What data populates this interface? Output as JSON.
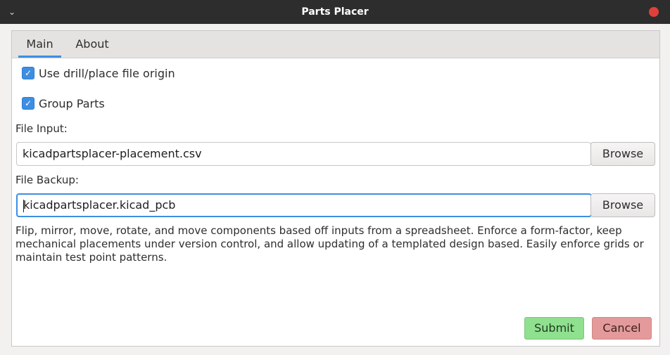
{
  "window": {
    "title": "Parts Placer",
    "menu_icon": "chevron-down-icon",
    "close_icon": "close-icon",
    "close_color": "#e0403a"
  },
  "tabs": [
    {
      "label": "Main",
      "active": true
    },
    {
      "label": "About",
      "active": false
    }
  ],
  "options": {
    "use_origin": {
      "label": "Use drill/place file origin",
      "checked": true
    },
    "group_parts": {
      "label": "Group Parts",
      "checked": true
    }
  },
  "file_input": {
    "label": "File Input:",
    "value": "kicadpartsplacer-placement.csv",
    "browse_label": "Browse"
  },
  "file_backup": {
    "label": "File Backup:",
    "value": "kicadpartsplacer.kicad_pcb",
    "browse_label": "Browse"
  },
  "description": "Flip, mirror, move, rotate, and move components based off inputs from a spreadsheet. Enforce a form-factor, keep mechanical placements under version control, and allow updating of a templated design based. Easily enforce grids or maintain test point patterns.",
  "actions": {
    "submit_label": "Submit",
    "cancel_label": "Cancel"
  },
  "colors": {
    "accent": "#3d8ee3",
    "submit": "#8fe08f",
    "cancel": "#e49a9a",
    "titlebar": "#2d2d2d"
  }
}
